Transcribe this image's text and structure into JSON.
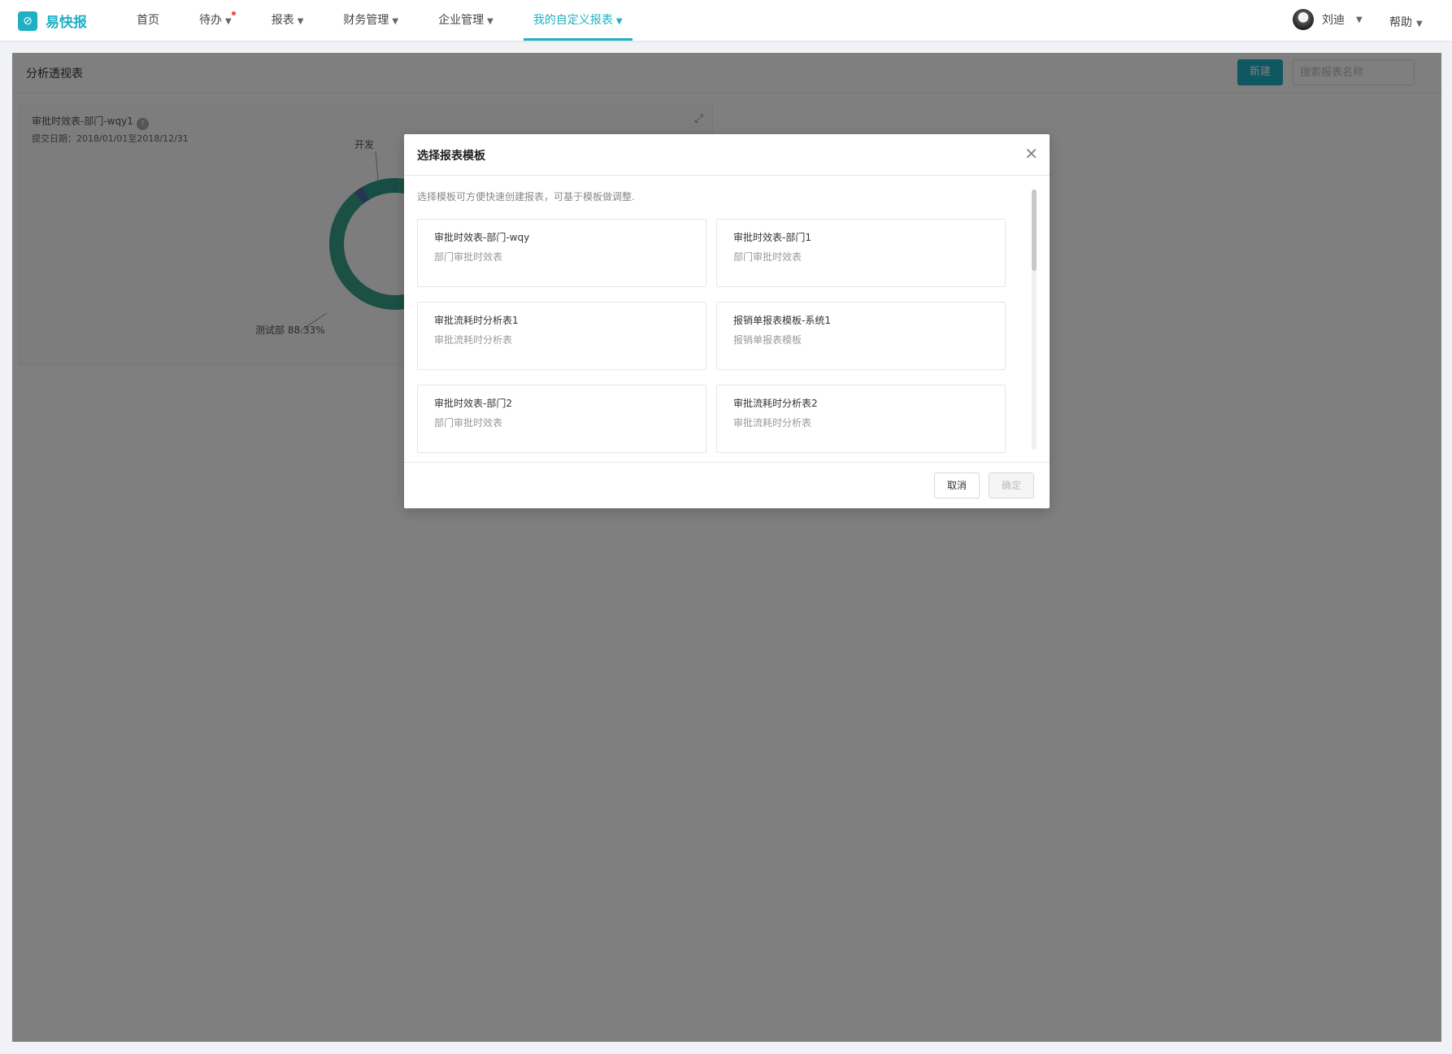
{
  "app": {
    "logo_text": "易快报",
    "logo_icon": "swirl-logo-icon"
  },
  "nav": [
    {
      "label": "首页",
      "caret": false,
      "active": false
    },
    {
      "label": "待办",
      "caret": true,
      "active": false,
      "dot": true
    },
    {
      "label": "报表",
      "caret": true,
      "active": false
    },
    {
      "label": "财务管理",
      "caret": true,
      "active": false
    },
    {
      "label": "企业管理",
      "caret": true,
      "active": false
    },
    {
      "label": "我的自定义报表",
      "caret": true,
      "active": true
    }
  ],
  "user": {
    "name": "刘迪"
  },
  "help": {
    "label": "帮助"
  },
  "page": {
    "title": "分析透视表",
    "new_button": "新建",
    "search_placeholder": "搜索报表名称"
  },
  "report_card": {
    "title": "审批时效表-部门-wqy1",
    "date_range": "提交日期：2018/01/01至2018/12/31"
  },
  "chart_data": {
    "type": "pie",
    "donut": true,
    "slices": [
      {
        "name": "测试部",
        "value": 88.33,
        "label": "测试部 88.33%",
        "color": "#3aa08a"
      },
      {
        "name": "开发",
        "value": 2.5,
        "label": "开发",
        "color": "#4a6fa0"
      },
      {
        "name": "",
        "value": 9.17,
        "label": "",
        "color": "#2f9a8e"
      }
    ]
  },
  "modal": {
    "title": "选择报表模板",
    "hint": "选择模板可方便快速创建报表，可基于模板做调整.",
    "templates": [
      {
        "name": "审批时效表-部门-wqy",
        "desc": "部门审批时效表"
      },
      {
        "name": "审批时效表-部门1",
        "desc": "部门审批时效表"
      },
      {
        "name": "审批流耗时分析表1",
        "desc": "审批流耗时分析表"
      },
      {
        "name": "报销单报表模板-系统1",
        "desc": "报销单报表模板"
      },
      {
        "name": "审批时效表-部门2",
        "desc": "部门审批时效表"
      },
      {
        "name": "审批流耗时分析表2",
        "desc": "审批流耗时分析表"
      }
    ],
    "cancel_label": "取消",
    "ok_label": "确定"
  }
}
